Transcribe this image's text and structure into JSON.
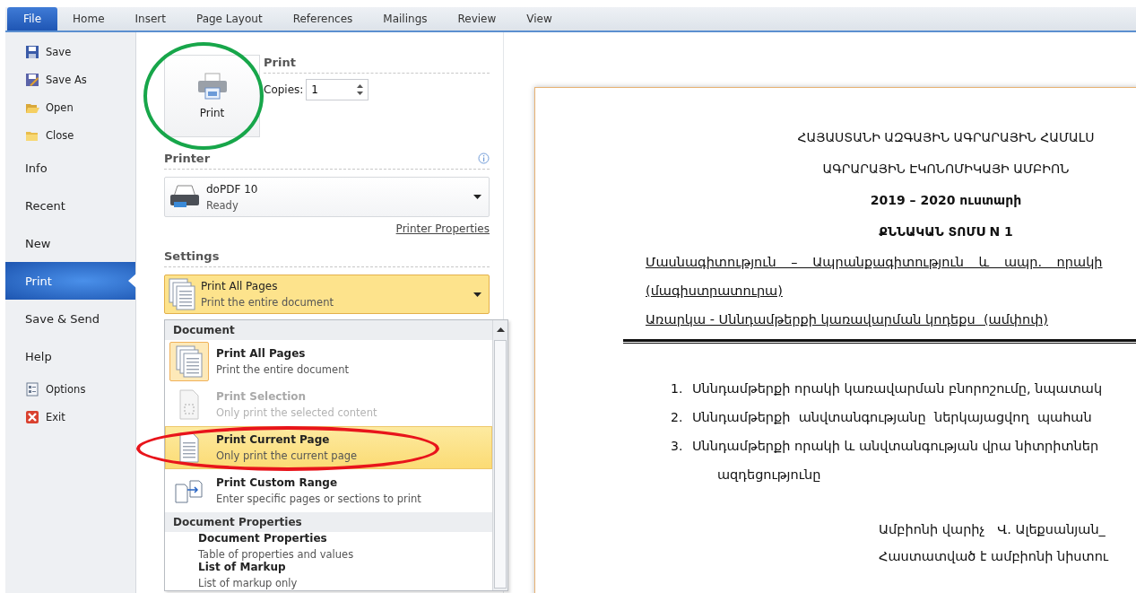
{
  "ribbon_tabs": [
    {
      "label": "File",
      "selected": true
    },
    {
      "label": "Home",
      "selected": false
    },
    {
      "label": "Insert",
      "selected": false
    },
    {
      "label": "Page Layout",
      "selected": false
    },
    {
      "label": "References",
      "selected": false
    },
    {
      "label": "Mailings",
      "selected": false
    },
    {
      "label": "Review",
      "selected": false
    },
    {
      "label": "View",
      "selected": false
    }
  ],
  "backstage_menu": [
    {
      "label": "Save",
      "kind": "command",
      "selected": false
    },
    {
      "label": "Save As",
      "kind": "command",
      "selected": false
    },
    {
      "label": "Open",
      "kind": "command",
      "selected": false
    },
    {
      "label": "Close",
      "kind": "command",
      "selected": false
    },
    {
      "label": "Info",
      "kind": "page",
      "selected": false
    },
    {
      "label": "Recent",
      "kind": "page",
      "selected": false
    },
    {
      "label": "New",
      "kind": "page",
      "selected": false
    },
    {
      "label": "Print",
      "kind": "page",
      "selected": true
    },
    {
      "label": "Save & Send",
      "kind": "page",
      "selected": false
    },
    {
      "label": "Help",
      "kind": "page",
      "selected": false
    },
    {
      "label": "Options",
      "kind": "command",
      "selected": false
    },
    {
      "label": "Exit",
      "kind": "command",
      "selected": false
    }
  ],
  "print": {
    "title": "Print",
    "button_label": "Print",
    "copies_label": "Copies:",
    "copies_value": "1"
  },
  "printer": {
    "title": "Printer",
    "name": "doPDF 10",
    "status": "Ready",
    "properties_link": "Printer Properties"
  },
  "settings": {
    "title": "Settings",
    "dropdown": {
      "title": "Print All Pages",
      "description": "Print the entire document"
    },
    "menu_groups": [
      {
        "heading": "Document",
        "items": [
          {
            "title": "Print All Pages",
            "description": "Print the entire document",
            "selected": true,
            "hovered": false,
            "disabled": false
          },
          {
            "title": "Print Selection",
            "description": "Only print the selected content",
            "selected": false,
            "hovered": false,
            "disabled": true
          },
          {
            "title": "Print Current Page",
            "description": "Only print the current page",
            "selected": false,
            "hovered": true,
            "disabled": false
          },
          {
            "title": "Print Custom Range",
            "description": "Enter specific pages or sections to print",
            "selected": false,
            "hovered": false,
            "disabled": false
          }
        ]
      },
      {
        "heading": "Document Properties",
        "items": [
          {
            "title": "Document Properties",
            "description": "Table of properties and values",
            "selected": false,
            "hovered": false,
            "disabled": false
          },
          {
            "title": "List of Markup",
            "description": "List of markup only",
            "selected": false,
            "hovered": false,
            "disabled": false
          }
        ]
      }
    ]
  },
  "document": {
    "heading_lines": [
      "ՀԱՅԱՍՏԱՆԻ ԱԶԳԱՅԻՆ ԱԳՐԱՐԱՅԻՆ ՀԱՄԱԼՍ",
      "ԱԳՐԱՐԱՅԻՆ ԷԿՈՆՈՄԻԿԱՅԻ ԱՄԲԻՈՆ",
      "2019 – 2020 ուստարի",
      "ՔՆՆԱԿԱՆ ՏՈՄՍ N 1"
    ],
    "underlined_lines": [
      "Մասնագիտություն – Ապրանքագիտություն և ապր. որակի",
      "(մագիստրատուրա)",
      "Առարկա - Սննդամթերքի կառավարման կոդեքս  (ամփոփ)"
    ],
    "list_items": [
      {
        "number": "1.",
        "text": "Սննդամթերքի որակի կառավարման բնորոշումը, նպատակ"
      },
      {
        "number": "2.",
        "text": "Սննդամթերքի  անվտանգությանը  ներկայացվող  պահան"
      },
      {
        "number": "3.",
        "text": "Սննդամթերքի որակի և անվտանգության վրա նիտրիտներ",
        "continuation": "ազդեցությունը"
      }
    ],
    "signature_lines": [
      "Ամբիոնի վարիչ   Վ. Ալեքսանյան_",
      "Հաստատված է ամբիոնի նիստու"
    ]
  },
  "annotations": [
    {
      "kind": "circle",
      "color": "#17a64a"
    },
    {
      "kind": "ellipse",
      "color": "#e8141b"
    }
  ]
}
